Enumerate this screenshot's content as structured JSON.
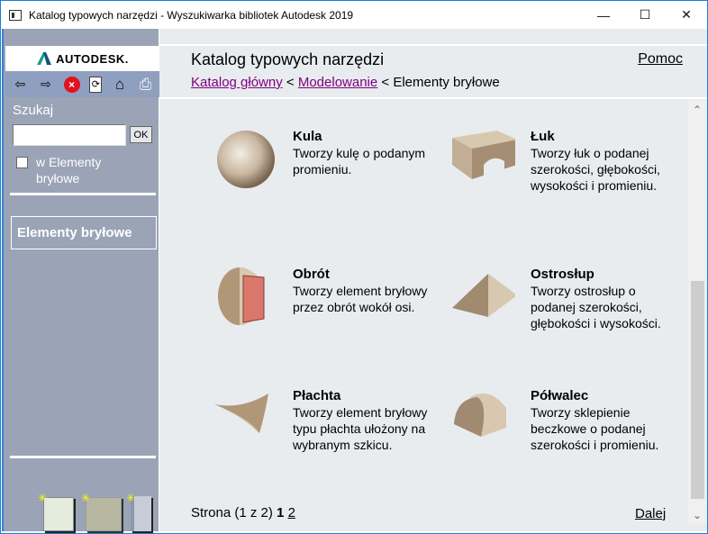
{
  "window": {
    "title": "Katalog typowych narzędzi - Wyszukiwarka bibliotek Autodesk 2019",
    "minimize": "—",
    "maximize": "☐",
    "close": "✕"
  },
  "sidebar": {
    "logo": "AUTODESK.",
    "toolbar": [
      {
        "icon": "back-arrow-icon",
        "glyph": "⇦"
      },
      {
        "icon": "forward-arrow-icon",
        "glyph": "⇨"
      },
      {
        "icon": "stop-icon",
        "glyph": "×"
      },
      {
        "icon": "refresh-icon",
        "glyph": "⟳"
      },
      {
        "icon": "home-icon",
        "glyph": "⌂"
      },
      {
        "icon": "print-icon",
        "glyph": "⎙"
      }
    ],
    "search_label": "Szukaj",
    "search_value": "",
    "ok": "OK",
    "scope_label": "w Elementy bryłowe",
    "scope_checked": false,
    "current": "Elementy bryłowe"
  },
  "main": {
    "title": "Katalog typowych narzędzi",
    "help": "Pomoc",
    "breadcrumb": {
      "root": "Katalog główny",
      "sep": "<",
      "mid": "Modelowanie",
      "current": "Elementy bryłowe"
    },
    "items": [
      {
        "name": "Kula",
        "desc": "Tworzy kulę o podanym promieniu.",
        "icon": "sphere-icon"
      },
      {
        "name": "Łuk",
        "desc": "Tworzy łuk o podanej szerokości, głębokości, wysokości i promieniu.",
        "icon": "arch-icon"
      },
      {
        "name": "Obrót",
        "desc": "Tworzy element bryłowy przez obrót wokół osi.",
        "icon": "revolve-icon"
      },
      {
        "name": "Ostrosłup",
        "desc": "Tworzy ostrosłup o podanej szerokości, głębokości i wysokości.",
        "icon": "pyramid-icon"
      },
      {
        "name": "Płachta",
        "desc": "Tworzy element bryłowy typu płachta ułożony na wybranym szkicu.",
        "icon": "sheet-icon"
      },
      {
        "name": "Półwalec",
        "desc": "Tworzy sklepienie beczkowe o podanej szerokości i promieniu.",
        "icon": "half-cylinder-icon"
      }
    ],
    "pager": {
      "label": "Strona (1 z 2)",
      "current": "1",
      "other": "2",
      "next": "Dalej"
    }
  }
}
